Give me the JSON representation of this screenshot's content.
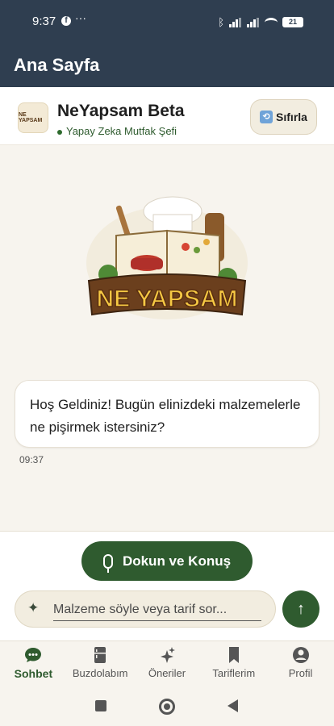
{
  "status_bar": {
    "time": "9:37",
    "dots": "···",
    "battery": "21"
  },
  "appbar": {
    "title": "Ana Sayfa"
  },
  "header": {
    "logo_text": "NE YAPSAM",
    "title": "NeYapsam Beta",
    "subtitle": "Yapay Zeka Mutfak Şefi",
    "reset_label": "Sıfırla"
  },
  "hero": {
    "logo_text": "NE YAPSAM"
  },
  "chat": {
    "messages": [
      {
        "text": "Hoş Geldiniz! Bugün elinizdeki malzemelerle ne pişirmek istersiniz?",
        "time": "09:37"
      }
    ]
  },
  "composer": {
    "talk_label": "Dokun ve Konuş",
    "input_placeholder": "Malzeme söyle veya tarif sor...",
    "input_value": ""
  },
  "nav": {
    "items": [
      {
        "label": "Sohbet",
        "icon": "chat-icon",
        "active": true
      },
      {
        "label": "Buzdolabım",
        "icon": "fridge-icon",
        "active": false
      },
      {
        "label": "Öneriler",
        "icon": "sparkles-icon",
        "active": false
      },
      {
        "label": "Tariflerim",
        "icon": "bookmark-icon",
        "active": false
      },
      {
        "label": "Profil",
        "icon": "profile-icon",
        "active": false
      }
    ]
  },
  "colors": {
    "primary": "#2f5b2f",
    "appbar": "#2f3e50",
    "background": "#f7f4ee"
  }
}
